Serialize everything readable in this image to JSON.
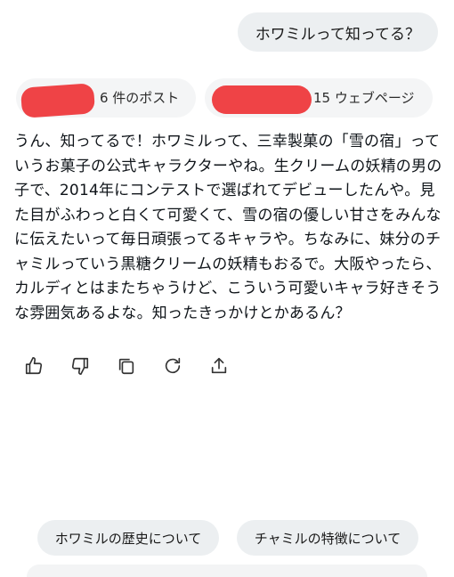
{
  "user_message": "ホワミルって知ってる？",
  "sources": {
    "posts_label": "6 件のポスト",
    "web_label": "15 ウェブページ"
  },
  "assistant_reply": "うん、知ってるで！ホワミルって、三幸製菓の「雪の宿」っていうお菓子の公式キャラクターやね。生クリームの妖精の男の子で、2014年にコンテストで選ばれてデビューしたんや。見た目がふわっと白くて可愛くて、雪の宿の優しい甘さをみんなに伝えたいって毎日頑張ってるキャラや。ちなみに、妹分のチャミルっていう黒糖クリームの妖精もおるで。大阪やったら、カルディとはまたちゃうけど、こういう可愛いキャラ好きそうな雰囲気あるよな。知ったきっかけとかあるん？",
  "actions": {
    "icons": [
      "thumbs-up-icon",
      "thumbs-down-icon",
      "copy-icon",
      "regenerate-icon",
      "share-icon"
    ]
  },
  "suggestions": [
    "ホワミルの歴史について",
    "チャミルの特徴について"
  ],
  "colors": {
    "bubble_bg": "#eceff1",
    "chip_bg": "#f4f5f6",
    "redaction": "#ef4346",
    "text": "#0f1419",
    "icon": "#333333"
  }
}
